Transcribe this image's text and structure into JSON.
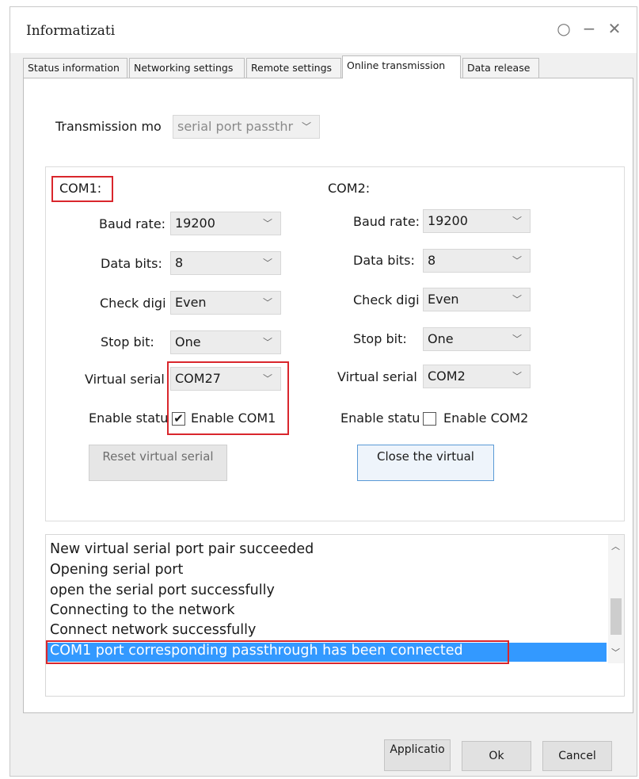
{
  "window": {
    "title": "Informatizati",
    "controls": {
      "refresh": "○",
      "minimize": "−",
      "close": "✕"
    }
  },
  "tabs": [
    {
      "label": "Status information",
      "active": false
    },
    {
      "label": "Networking settings",
      "active": false
    },
    {
      "label": "Remote settings",
      "active": false
    },
    {
      "label": "Online transmission",
      "active": true
    },
    {
      "label": "Data release",
      "active": false
    }
  ],
  "transmission": {
    "label": "Transmission mo",
    "value": "serial port passthr"
  },
  "com1": {
    "header": "COM1:",
    "baud_label": "Baud rate:",
    "baud_value": "19200",
    "databits_label": "Data bits:",
    "databits_value": "8",
    "check_label": "Check digi",
    "check_value": "Even",
    "stop_label": "Stop bit:",
    "stop_value": "One",
    "virtual_label": "Virtual serial",
    "virtual_value": "COM27",
    "enable_label": "Enable statu",
    "enable_checkbox_label": "Enable COM1",
    "enabled": true,
    "button": "Reset virtual serial"
  },
  "com2": {
    "header": "COM2:",
    "baud_label": "Baud rate:",
    "baud_value": "19200",
    "databits_label": "Data bits:",
    "databits_value": "8",
    "check_label": "Check digi",
    "check_value": "Even",
    "stop_label": "Stop bit:",
    "stop_value": "One",
    "virtual_label": "Virtual serial",
    "virtual_value": "COM2",
    "enable_label": "Enable statu",
    "enable_checkbox_label": "Enable COM2",
    "enabled": false,
    "button": "Close the virtual"
  },
  "log": {
    "lines": [
      "New virtual serial port pair succeeded",
      "Opening serial port",
      "open the serial port successfully",
      "Connecting to the network",
      "Connect network successfully",
      "COM1 port corresponding passthrough has been connected"
    ],
    "selected_index": 5
  },
  "footer": {
    "apply": "Applicatio",
    "ok": "Ok",
    "cancel": "Cancel"
  },
  "colors": {
    "highlight": "#3399ff",
    "annotation_red": "#d9262c"
  }
}
